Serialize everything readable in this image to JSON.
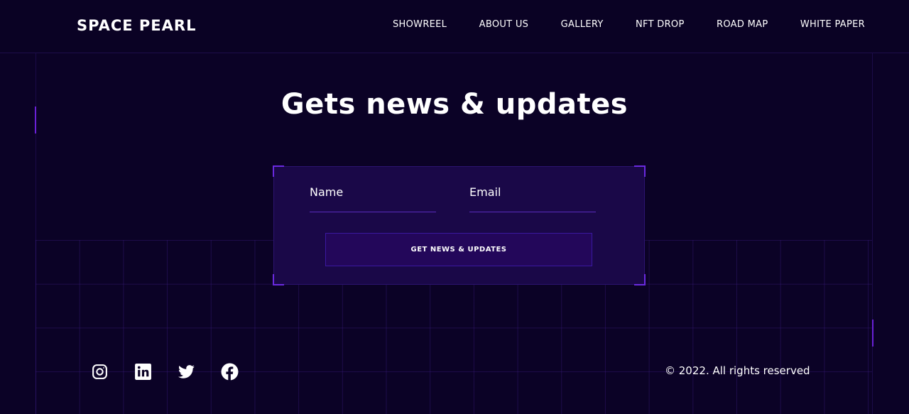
{
  "brand": "SPACE PEARL",
  "nav": {
    "items": [
      {
        "label": "SHOWREEL"
      },
      {
        "label": "ABOUT US"
      },
      {
        "label": "GALLERY"
      },
      {
        "label": "NFT DROP"
      },
      {
        "label": "ROAD MAP"
      },
      {
        "label": "WHITE PAPER"
      }
    ]
  },
  "headline": "Gets news & updates",
  "form": {
    "name_placeholder": "Name",
    "email_placeholder": "Email",
    "submit_label": "GET NEWS & UPDATES"
  },
  "social": [
    "instagram-icon",
    "linkedin-icon",
    "twitter-icon",
    "facebook-icon"
  ],
  "footer": {
    "copyright": "© 2022. All rights reserved"
  },
  "colors": {
    "background": "#0b0226",
    "accent": "#6a21d8",
    "form_bg": "#1a0848",
    "button_bg": "#23075a"
  }
}
